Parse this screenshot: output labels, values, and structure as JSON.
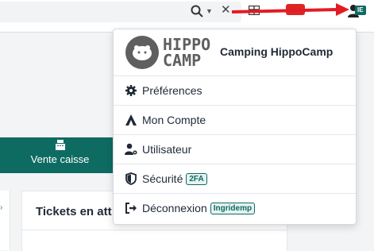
{
  "topbar": {
    "notification_count": "",
    "user_initials": "IE"
  },
  "pos_button": {
    "label": "Vente caisse"
  },
  "tickets_card": {
    "title": "Tickets en att"
  },
  "left_card": {
    "label": "›"
  },
  "dropdown": {
    "company": {
      "logo_line1": "HIPPO",
      "logo_line2": "CAMP",
      "name": "Camping HippoCamp"
    },
    "items": [
      {
        "label": "Préférences",
        "icon": "gear-icon"
      },
      {
        "label": "Mon Compte",
        "icon": "tent-icon"
      },
      {
        "label": "Utilisateur",
        "icon": "user-cog-icon"
      },
      {
        "label": "Sécurité",
        "icon": "shield-icon",
        "tag": "2FA"
      },
      {
        "label": "Déconnexion",
        "icon": "logout-icon",
        "tag": "Ingridemp"
      }
    ]
  },
  "colors": {
    "accent": "#0e6b62",
    "arrow": "#e31b23"
  }
}
